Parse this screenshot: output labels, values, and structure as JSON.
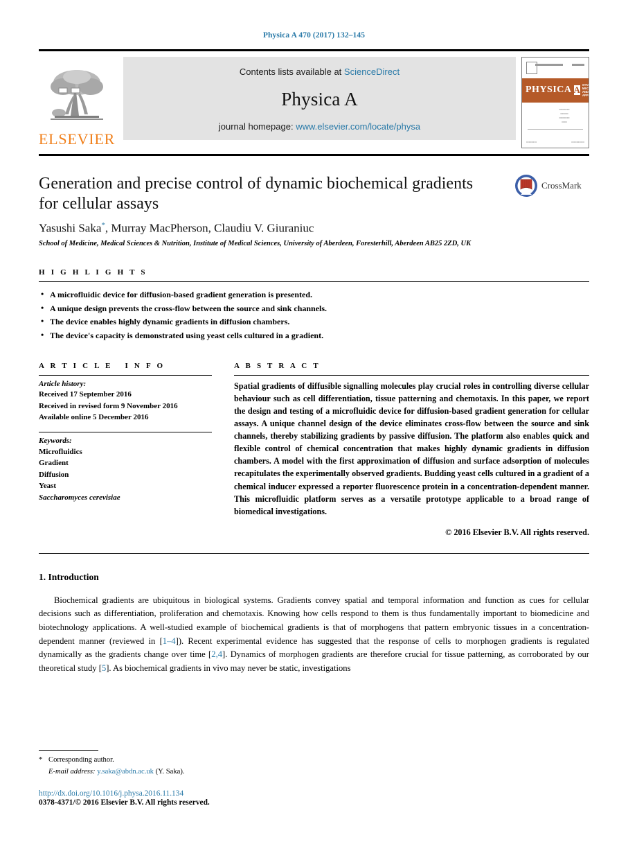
{
  "running_head": "Physica A 470 (2017) 132–145",
  "masthead": {
    "publisher_wordmark": "ELSEVIER",
    "contents_prefix": "Contents lists available at ",
    "contents_link": "ScienceDirect",
    "journal_title": "Physica A",
    "homepage_prefix": "journal homepage: ",
    "homepage_link": "www.elsevier.com/locate/physa",
    "cover": {
      "journal_name": "PHYSICA",
      "volume_letter": "A",
      "subtitle": "STATISTICAL MECHANICS AND ITS APPLICATIONS"
    }
  },
  "article": {
    "title": "Generation and precise control of dynamic biochemical gradients for cellular assays",
    "authors": "Yasushi Saka",
    "corresponding_marker": "*",
    "authors_rest": ",  Murray MacPherson,  Claudiu V. Giuraniuc",
    "affiliation": "School of Medicine, Medical Sciences & Nutrition, Institute of Medical Sciences, University of Aberdeen, Foresterhill, Aberdeen AB25 2ZD, UK",
    "crossmark_label": "CrossMark"
  },
  "highlights": {
    "heading": "HIGHLIGHTS",
    "items": [
      "A microfluidic device for diffusion-based gradient generation is presented.",
      "A unique design prevents the cross-flow between the source and sink channels.",
      "The device enables highly dynamic gradients in diffusion chambers.",
      "The device's capacity is demonstrated using yeast cells cultured in a gradient."
    ]
  },
  "article_info": {
    "heading": "ARTICLE INFO",
    "history_label": "Article history:",
    "history": [
      "Received 17 September 2016",
      "Received in revised form 9 November 2016",
      "Available online 5 December 2016"
    ],
    "keywords_label": "Keywords:",
    "keywords": [
      "Microfluidics",
      "Gradient",
      "Diffusion",
      "Yeast"
    ],
    "keyword_italic": "Saccharomyces cerevisiae"
  },
  "abstract": {
    "heading": "ABSTRACT",
    "text": "Spatial gradients of diffusible signalling molecules play crucial roles in controlling diverse cellular behaviour such as cell differentiation, tissue patterning and chemotaxis. In this paper, we report the design and testing of a microfluidic device for diffusion-based gradient generation for cellular assays. A unique channel design of the device eliminates cross-flow between the source and sink channels, thereby stabilizing gradients by passive diffusion. The platform also enables quick and flexible control of chemical concentration that makes highly dynamic gradients in diffusion chambers. A model with the first approximation of diffusion and surface adsorption of molecules recapitulates the experimentally observed gradients. Budding yeast cells cultured in a gradient of a chemical inducer expressed a reporter fluorescence protein in a concentration-dependent manner. This microfluidic platform serves as a versatile prototype applicable to a broad range of biomedical investigations.",
    "copyright": "© 2016 Elsevier B.V. All rights reserved."
  },
  "introduction": {
    "number_title": "1. Introduction",
    "para_1_a": "Biochemical gradients are ubiquitous in biological systems. Gradients convey spatial and temporal information and function as cues for cellular decisions such as differentiation, proliferation and chemotaxis. Knowing how cells respond to them is thus fundamentally important to biomedicine and biotechnology applications. A well-studied example of biochemical gradients is that of morphogens that pattern embryonic tissues in a concentration-dependent manner (reviewed in [",
    "cite_1": "1–4",
    "para_1_b": "]). Recent experimental evidence has suggested that the response of cells to morphogen gradients is regulated dynamically as the gradients change over time [",
    "cite_2": "2,4",
    "para_1_c": "]. Dynamics of morphogen gradients are therefore crucial for tissue patterning, as corroborated by our theoretical study [",
    "cite_3": "5",
    "para_1_d": "]. As biochemical gradients in vivo may never be static, investigations"
  },
  "footer": {
    "corresponding_marker": "*",
    "corresponding_text": "Corresponding author.",
    "email_label": "E-mail address:",
    "email": "y.saka@abdn.ac.uk",
    "email_suffix": "(Y. Saka).",
    "doi": "http://dx.doi.org/10.1016/j.physa.2016.11.134",
    "issn_line": "0378-4371/© 2016 Elsevier B.V. All rights reserved."
  },
  "colors": {
    "link_blue": "#2a7aa8",
    "elsevier_orange": "#f07f1a",
    "cover_brown": "#b55a28",
    "band_gray": "#e3e3e3"
  }
}
